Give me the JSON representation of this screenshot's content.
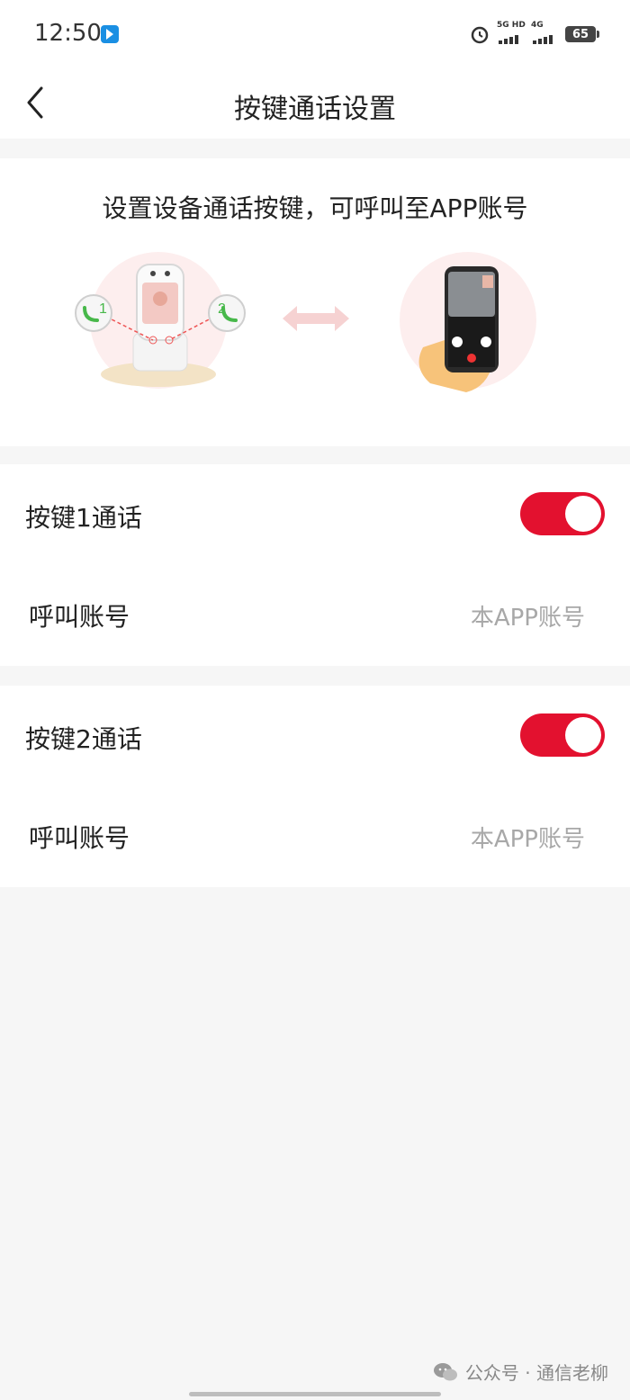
{
  "status_bar": {
    "time": "12:50",
    "network_1": "5G HD",
    "network_2": "4G",
    "battery": "65",
    "icons": [
      "app-badge-icon",
      "alarm-icon",
      "signal-icon",
      "battery-icon"
    ]
  },
  "header": {
    "title": "按键通话设置",
    "back_icon": "chevron-left-icon"
  },
  "intro": {
    "text": "设置设备通话按键，可呼叫至APP账号",
    "illustration": {
      "left_badge": "1",
      "right_badge": "2"
    }
  },
  "groups": [
    {
      "toggle_label": "按键1通话",
      "toggle_on": true,
      "account_label": "呼叫账号",
      "account_value": "本APP账号"
    },
    {
      "toggle_label": "按键2通话",
      "toggle_on": true,
      "account_label": "呼叫账号",
      "account_value": "本APP账号"
    }
  ],
  "watermark": {
    "text": "公众号 · 通信老柳"
  },
  "colors": {
    "accent": "#e3112f",
    "background": "#f6f6f6",
    "secondary_text": "#a8a8a8"
  }
}
